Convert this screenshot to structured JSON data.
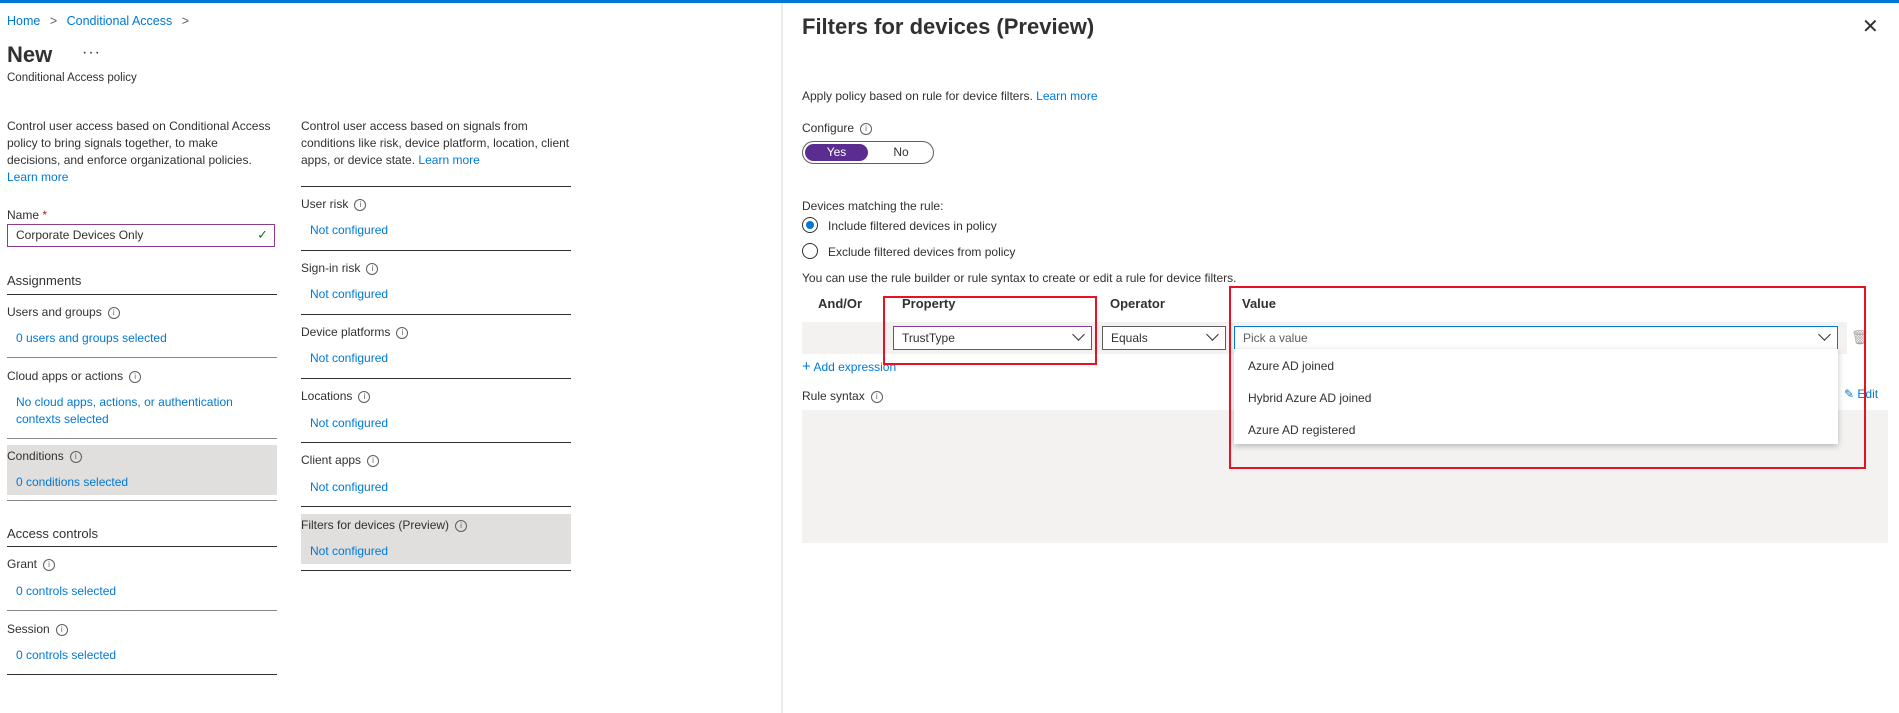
{
  "breadcrumb": {
    "items": [
      "Home",
      "Conditional Access"
    ],
    "separator": ">"
  },
  "page": {
    "title": "New",
    "more": "···",
    "subtitle": "Conditional Access policy"
  },
  "left": {
    "intro": "Control user access based on Conditional Access policy to bring signals together, to make decisions, and enforce organizational policies.",
    "learn_more": "Learn more",
    "name_label": "Name",
    "name_required": "*",
    "name_value": "Corporate Devices Only",
    "assignments_header": "Assignments",
    "assignments": [
      {
        "label": "Users and groups",
        "value": "0 users and groups selected"
      },
      {
        "label": "Cloud apps or actions",
        "value": "No cloud apps, actions, or authentication contexts selected"
      },
      {
        "label": "Conditions",
        "value": "0 conditions selected"
      }
    ],
    "access_header": "Access controls",
    "access": [
      {
        "label": "Grant",
        "value": "0 controls selected"
      },
      {
        "label": "Session",
        "value": "0 controls selected"
      }
    ]
  },
  "middle": {
    "intro": "Control user access based on signals from conditions like risk, device platform, location, client apps, or device state.",
    "learn_more": "Learn more",
    "items": [
      {
        "label": "User risk",
        "value": "Not configured"
      },
      {
        "label": "Sign-in risk",
        "value": "Not configured"
      },
      {
        "label": "Device platforms",
        "value": "Not configured"
      },
      {
        "label": "Locations",
        "value": "Not configured"
      },
      {
        "label": "Client apps",
        "value": "Not configured"
      },
      {
        "label": "Filters for devices (Preview)",
        "value": "Not configured"
      }
    ]
  },
  "panel": {
    "title": "Filters for devices (Preview)",
    "close": "✕",
    "description": "Apply policy based on rule for device filters.",
    "learn_more": "Learn more",
    "configure_label": "Configure",
    "toggle_yes": "Yes",
    "toggle_no": "No",
    "matching_label": "Devices matching the rule:",
    "radio_include": "Include filtered devices in policy",
    "radio_exclude": "Exclude filtered devices from policy",
    "builder_hint": "You can use the rule builder or rule syntax to create or edit a rule for device filters.",
    "columns": {
      "andor": "And/Or",
      "property": "Property",
      "operator": "Operator",
      "value": "Value"
    },
    "property_value": "TrustType",
    "operator_value": "Equals",
    "value_placeholder": "Pick a value",
    "value_options": [
      "Azure AD joined",
      "Hybrid Azure AD joined",
      "Azure AD registered"
    ],
    "add_expression": "Add expression",
    "rule_syntax_label": "Rule syntax",
    "edit": "Edit"
  },
  "colors": {
    "accent": "#0078d4",
    "toggle_on": "#5c2d91",
    "highlight": "#e81123",
    "shade": "#e1dfdd"
  }
}
